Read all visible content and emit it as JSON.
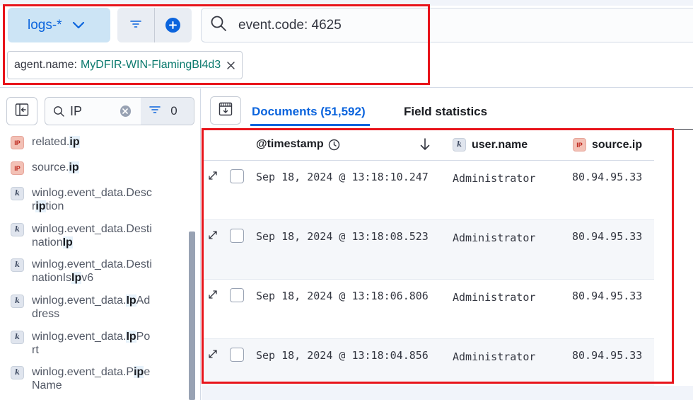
{
  "query_bar": {
    "dataview_label": "logs-*",
    "query_text": "event.code: 4625",
    "filter_pill": {
      "key": "agent.name:",
      "value": "MyDFIR-WIN-FlamingBl4d3"
    }
  },
  "sidebar": {
    "search_value": "IP",
    "filter_count": "0",
    "fields": [
      {
        "type": "ip",
        "type_label": "IP",
        "parts": [
          [
            "related.",
            false
          ],
          [
            "ip",
            true
          ]
        ]
      },
      {
        "type": "ip",
        "type_label": "IP",
        "parts": [
          [
            "source.",
            false
          ],
          [
            "ip",
            true
          ]
        ]
      },
      {
        "type": "keyword",
        "type_label": "k",
        "parts": [
          [
            "winlog.event_data.Descr",
            false
          ],
          [
            "ip",
            true
          ],
          [
            "tion",
            false
          ]
        ]
      },
      {
        "type": "keyword",
        "type_label": "k",
        "parts": [
          [
            "winlog.event_data.Destination",
            false
          ],
          [
            "Ip",
            true
          ]
        ]
      },
      {
        "type": "keyword",
        "type_label": "k",
        "parts": [
          [
            "winlog.event_data.DestinationIs",
            false
          ],
          [
            "Ip",
            true
          ],
          [
            "v6",
            false
          ]
        ]
      },
      {
        "type": "keyword",
        "type_label": "k",
        "parts": [
          [
            "winlog.event_data.",
            false
          ],
          [
            "Ip",
            true
          ],
          [
            "Address",
            false
          ]
        ]
      },
      {
        "type": "keyword",
        "type_label": "k",
        "parts": [
          [
            "winlog.event_data.",
            false
          ],
          [
            "Ip",
            true
          ],
          [
            "Port",
            false
          ]
        ]
      },
      {
        "type": "keyword",
        "type_label": "k",
        "parts": [
          [
            "winlog.event_data.P",
            false
          ],
          [
            "ip",
            true
          ],
          [
            "eName",
            false
          ]
        ]
      }
    ]
  },
  "tabs": {
    "documents_label": "Documents (51,592)",
    "field_stats_label": "Field statistics"
  },
  "grid": {
    "columns": {
      "timestamp": "@timestamp",
      "user_name": "user.name",
      "user_type_label": "k",
      "source_ip": "source.ip",
      "ip_type_label": "IP"
    },
    "rows": [
      {
        "timestamp": "Sep 18, 2024 @ 13:18:10.247",
        "user_name": "Administrator",
        "source_ip": "80.94.95.33"
      },
      {
        "timestamp": "Sep 18, 2024 @ 13:18:08.523",
        "user_name": "Administrator",
        "source_ip": "80.94.95.33"
      },
      {
        "timestamp": "Sep 18, 2024 @ 13:18:06.806",
        "user_name": "Administrator",
        "source_ip": "80.94.95.33"
      },
      {
        "timestamp": "Sep 18, 2024 @ 13:18:04.856",
        "user_name": "Administrator",
        "source_ip": "80.94.95.33"
      }
    ]
  },
  "colors": {
    "accent": "#0b64dd",
    "highlight_box": "#e8141b",
    "ip_badge": "#f3c1b6",
    "keyword_badge": "#e0e5ee"
  }
}
